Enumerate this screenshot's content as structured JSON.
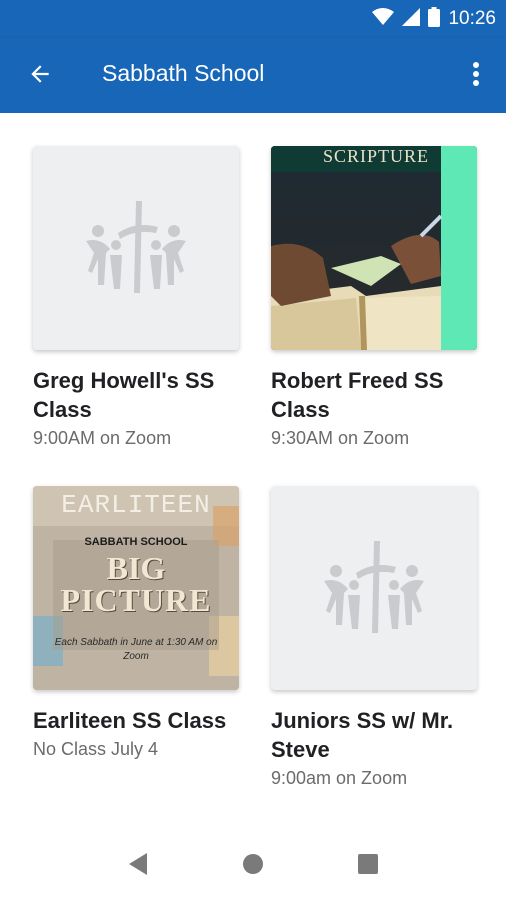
{
  "status_bar": {
    "time": "10:26",
    "icons": [
      "wifi-icon",
      "signal-icon",
      "battery-icon"
    ]
  },
  "app_bar": {
    "title": "Sabbath School",
    "back_icon": "arrow-back-icon",
    "menu_icon": "more-vert-icon"
  },
  "colors": {
    "primary": "#1866b7",
    "title_text": "#202124",
    "subtitle_text": "#6b6b6b",
    "accent_strip": "#5ee8b6"
  },
  "cards": [
    {
      "title": "Greg Howell's SS Class",
      "subtitle": "9:00AM on Zoom",
      "image": "church-logo-placeholder"
    },
    {
      "title": "Robert Freed SS Class",
      "subtitle": "9:30AM on Zoom",
      "image": "scripture-photo",
      "image_text": "SCRIPTURE"
    },
    {
      "title": "Earliteen SS Class",
      "subtitle": "No Class July 4",
      "image": "earliteen-poster",
      "image_text": {
        "heading": "EARLITEEN",
        "line1": "SABBATH SCHOOL",
        "line2": "BIG",
        "line3": "PICTURE",
        "line4": "Each Sabbath in June at 1:30 AM on Zoom"
      }
    },
    {
      "title": "Juniors SS w/ Mr. Steve",
      "subtitle": "9:00am on Zoom",
      "image": "church-logo-placeholder"
    }
  ],
  "nav_bar": {
    "icons": [
      "back-triangle-icon",
      "home-circle-icon",
      "recents-square-icon"
    ]
  }
}
